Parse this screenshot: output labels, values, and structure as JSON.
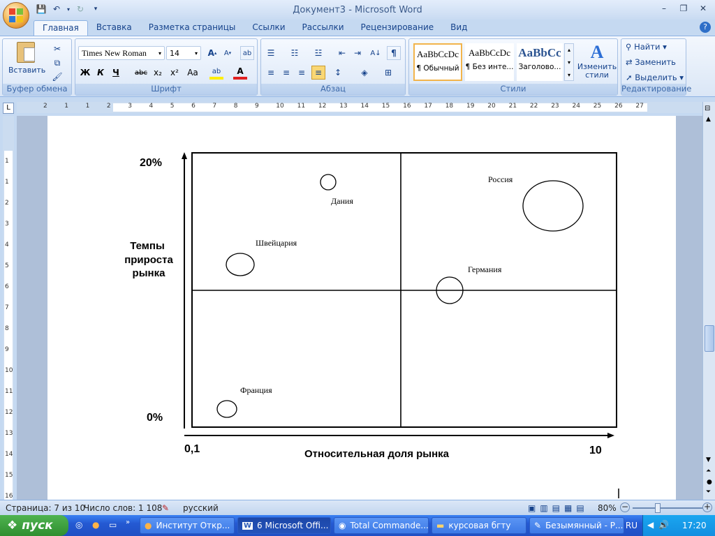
{
  "window": {
    "title": "Документ3 - Microsoft Word"
  },
  "tabs": [
    "Главная",
    "Вставка",
    "Разметка страницы",
    "Ссылки",
    "Рассылки",
    "Рецензирование",
    "Вид"
  ],
  "ribbon": {
    "clipboard": {
      "paste_label": "Вставить",
      "group_label": "Буфер обмена"
    },
    "font": {
      "name": "Times New Roman",
      "size": "14",
      "group_label": "Шрифт",
      "bold": "Ж",
      "italic": "К",
      "underline": "Ч",
      "strike": "abc",
      "sub": "x₂",
      "sup": "x²",
      "case": "Aa"
    },
    "paragraph": {
      "group_label": "Абзац"
    },
    "styles": {
      "group_label": "Стили",
      "items": [
        {
          "preview": "AaBbCcDc",
          "name": "¶ Обычный"
        },
        {
          "preview": "AaBbCcDc",
          "name": "¶ Без инте..."
        },
        {
          "preview": "AaBbCc",
          "name": "Заголово..."
        }
      ],
      "change_label": "Изменить стили"
    },
    "editing": {
      "group_label": "Редактирование",
      "find": "Найти",
      "replace": "Заменить",
      "select": "Выделить"
    }
  },
  "ruler": {
    "top_numbers": [
      "2",
      "1",
      "1",
      "2",
      "3",
      "4",
      "5",
      "6",
      "7",
      "8",
      "9",
      "10",
      "11",
      "12",
      "13",
      "14",
      "15",
      "16",
      "17",
      "18",
      "19",
      "20",
      "21",
      "22",
      "23",
      "24",
      "25",
      "26",
      "27"
    ],
    "side_numbers": [
      "1",
      "1",
      "2",
      "3",
      "4",
      "5",
      "6",
      "7",
      "8",
      "9",
      "10",
      "11",
      "12",
      "13",
      "14",
      "15",
      "16"
    ]
  },
  "chart": {
    "y_top": "20%",
    "y_bottom": "0%",
    "y_title": [
      "Темпы",
      "прироста",
      "рынка"
    ],
    "x_left": "0,1",
    "x_right": "10",
    "x_title": "Относительная доля рынка",
    "bubbles": [
      {
        "label": "Дания"
      },
      {
        "label": "Россия"
      },
      {
        "label": "Швейцария"
      },
      {
        "label": "Германия"
      },
      {
        "label": "Франция"
      }
    ]
  },
  "status": {
    "page": "Страница: 7 из 10",
    "words": "Число слов: 1 108",
    "lang": "русский",
    "zoom": "80%"
  },
  "taskbar": {
    "start": "пуск",
    "items": [
      "Институт Откр...",
      "6 Microsoft Offi...",
      "Total Commande...",
      "курсовая бгту",
      "Безымянный - Р..."
    ],
    "lang": "RU",
    "clock": "17:20"
  }
}
